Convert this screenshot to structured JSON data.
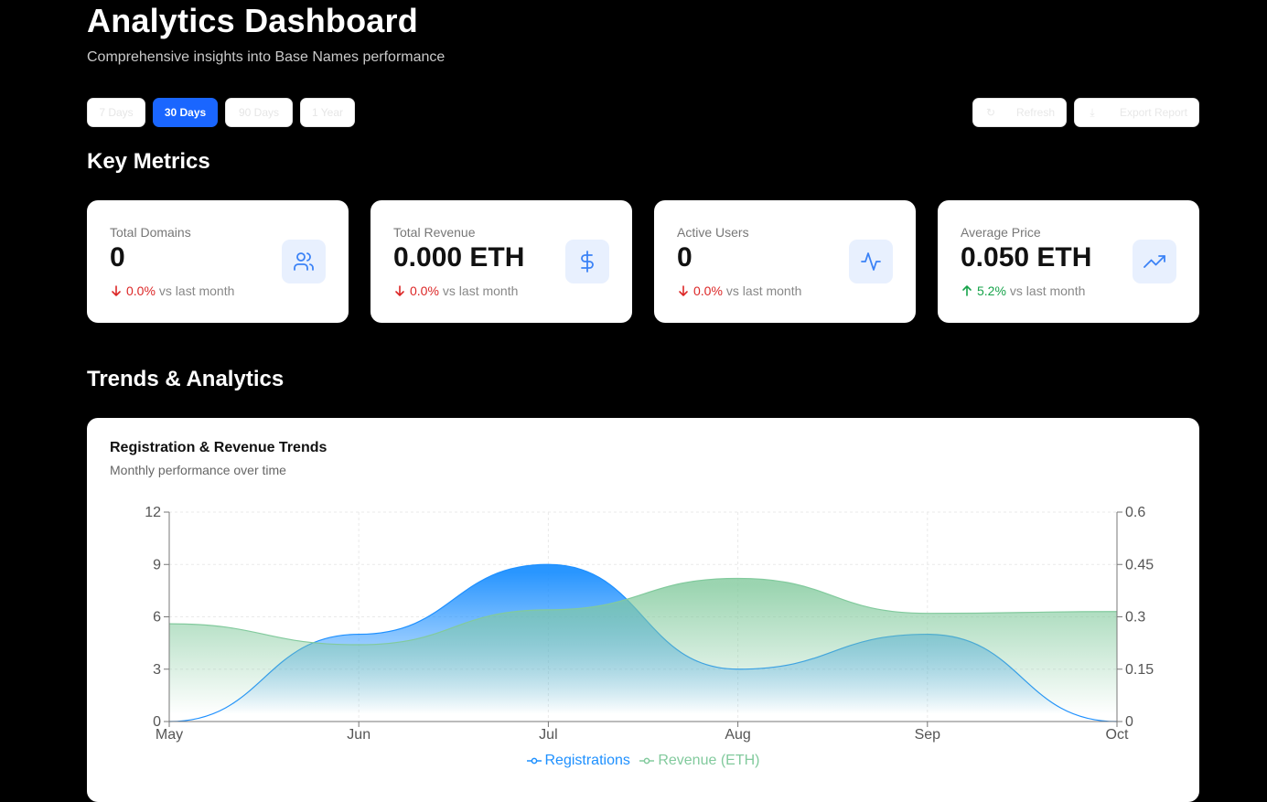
{
  "header": {
    "title": "Analytics Dashboard",
    "subtitle": "Comprehensive insights into Base Names performance"
  },
  "time_range": {
    "options": [
      "7 Days",
      "30 Days",
      "90 Days",
      "1 Year"
    ],
    "selected": "30 Days"
  },
  "actions": {
    "refresh_label": "Refresh",
    "refresh_icon": "refresh-icon",
    "export_label": "Export Report",
    "export_icon": "download-icon"
  },
  "sections": {
    "key_metrics": "Key Metrics",
    "trends": "Trends & Analytics"
  },
  "metrics": [
    {
      "label": "Total Domains",
      "value": "0",
      "change": "0.0%",
      "trend": "down",
      "suffix": "vs last month",
      "icon": "users-icon"
    },
    {
      "label": "Total Revenue",
      "value": "0.000 ETH",
      "change": "0.0%",
      "trend": "down",
      "suffix": "vs last month",
      "icon": "dollar-icon"
    },
    {
      "label": "Active Users",
      "value": "0",
      "change": "0.0%",
      "trend": "down",
      "suffix": "vs last month",
      "icon": "activity-icon"
    },
    {
      "label": "Average Price",
      "value": "0.050 ETH",
      "change": "5.2%",
      "trend": "up",
      "suffix": "vs last month",
      "icon": "trending-up-icon"
    }
  ],
  "colors": {
    "accent": "#1a66ff",
    "down": "#dc2626",
    "up": "#16a34a",
    "registrations": "#1e90ff",
    "revenue": "#82ca9d",
    "icon": "#3b82f6"
  },
  "chart_card": {
    "title": "Registration & Revenue Trends",
    "subtitle": "Monthly performance over time"
  },
  "chart_data": {
    "type": "area",
    "categories": [
      "May",
      "Jun",
      "Jul",
      "Aug",
      "Sep",
      "Oct"
    ],
    "series": [
      {
        "name": "Registrations",
        "axis": "left",
        "values": [
          0,
          5,
          9,
          3,
          5,
          0
        ]
      },
      {
        "name": "Revenue (ETH)",
        "axis": "right",
        "values": [
          0.28,
          0.22,
          0.32,
          0.41,
          0.31,
          0.315
        ]
      }
    ],
    "y_left": {
      "ticks": [
        "0",
        "3",
        "6",
        "9",
        "12"
      ],
      "range": [
        0,
        12
      ]
    },
    "y_right": {
      "ticks": [
        "0",
        "0.15",
        "0.3",
        "0.45",
        "0.6"
      ],
      "range": [
        0,
        0.6
      ]
    },
    "grid": true,
    "legend": "bottom"
  }
}
